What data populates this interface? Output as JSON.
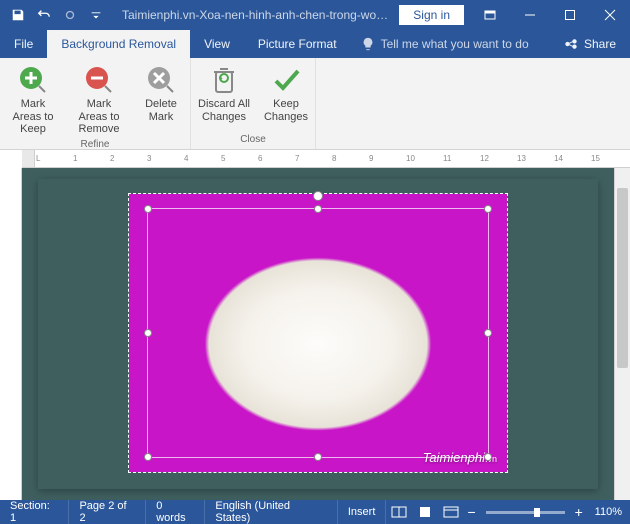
{
  "titlebar": {
    "doc_title": "Taimienphi.vn-Xoa-nen-hinh-anh-chen-trong-word....",
    "signin": "Sign in"
  },
  "tabs": {
    "file": "File",
    "bg_removal": "Background Removal",
    "view": "View",
    "picture_format": "Picture Format",
    "tellme": "Tell me what you want to do",
    "share": "Share"
  },
  "ribbon": {
    "mark_keep": "Mark Areas to Keep",
    "mark_remove": "Mark Areas to Remove",
    "delete_mark": "Delete Mark",
    "discard": "Discard All Changes",
    "keep": "Keep Changes",
    "group_refine": "Refine",
    "group_close": "Close"
  },
  "ruler_marks": [
    "L",
    "1",
    "2",
    "3",
    "4",
    "5",
    "6",
    "7",
    "8",
    "9",
    "10",
    "11",
    "12",
    "13",
    "14",
    "15"
  ],
  "watermark": {
    "text": "Taimienphi",
    "suffix": ".vn"
  },
  "status": {
    "section": "Section: 1",
    "page": "Page 2 of 2",
    "words": "0 words",
    "lang": "English (United States)",
    "insert": "Insert",
    "zoom": "110%"
  }
}
